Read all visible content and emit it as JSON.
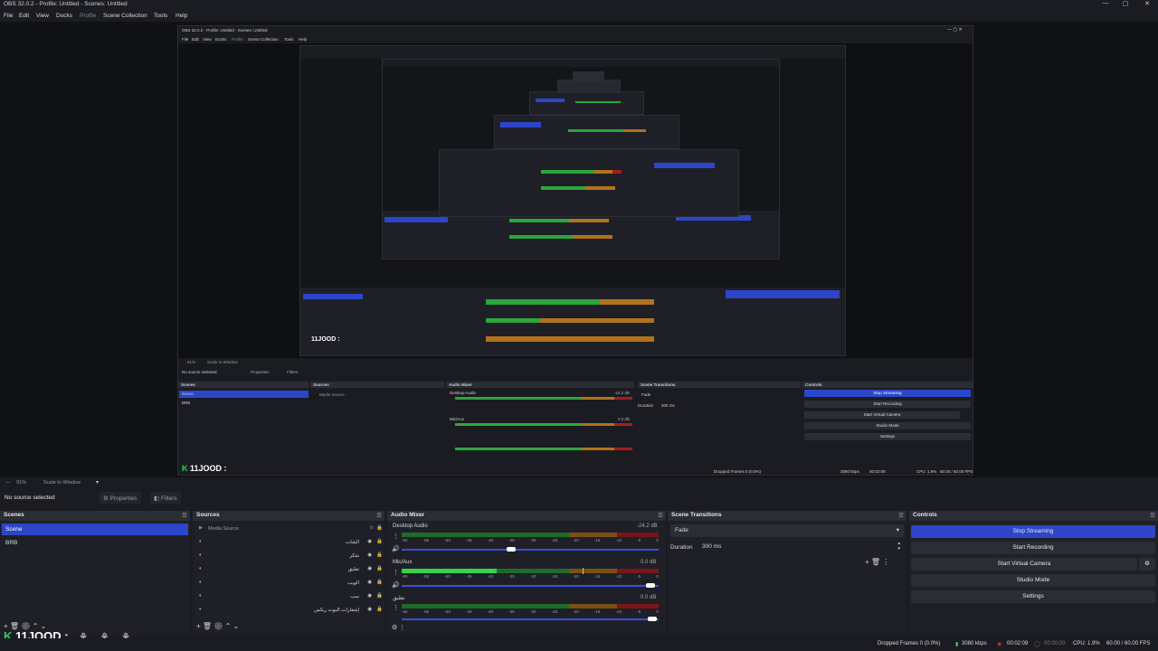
{
  "window": {
    "title": "OBS 32.0.2 - Profile: Untitled - Scenes: Untitled"
  },
  "menu": [
    "File",
    "Edit",
    "View",
    "Docks",
    "Profile",
    "Scene Collection",
    "Tools",
    "Help"
  ],
  "nested": {
    "title": "OBS 32.0.2 - Profile: Untitled - Scenes: Untitled",
    "menu": [
      "File",
      "Edit",
      "View",
      "Docks",
      "Profile",
      "Scene Collection",
      "Tools",
      "Help"
    ],
    "zoom": "91%",
    "scale": "Scale to Window",
    "no_source": "No source selected",
    "properties": "Properties",
    "filters": "Filters",
    "docks": {
      "scenes": "Scenes",
      "sources": "Sources",
      "mixer": "Audio Mixer",
      "transitions": "Scene Transitions",
      "controls": "Controls"
    },
    "scenes": [
      "Scene",
      "BRB"
    ],
    "media_source": "Media Source",
    "desktop_audio": "Desktop Audio",
    "desktop_db": "-24.2 dB",
    "mic_aux": "Mic/Aux",
    "mic_db": "0.0 dB",
    "fade": "Fade",
    "duration_label": "Duration",
    "duration_value": "300 ms",
    "controls": [
      "Stop Streaming",
      "Start Recording",
      "Start Virtual Camera",
      "Studio Mode",
      "Settings"
    ],
    "logo": "11JOOD :",
    "dropped": "Dropped Frames 0 (0.0%)",
    "kbps": "3080 kbps",
    "time": "00:02:09",
    "cpu": "CPU: 1.9%",
    "fps": "60.00 / 60.00 FPS"
  },
  "zoom": {
    "percent": "91%",
    "mode": "Scale to Window"
  },
  "source_toolbar": {
    "no_source": "No source selected",
    "properties": "Properties",
    "filters": "Filters"
  },
  "scenes": {
    "title": "Scenes",
    "items": [
      "Scene",
      "BRB"
    ],
    "selected": "Scene"
  },
  "sources": {
    "title": "Sources",
    "items": [
      "Media Source",
      "الشات",
      "شكر",
      "تعليق",
      "الويب",
      "سب",
      "إشعارات البوت ريكس"
    ]
  },
  "mixer": {
    "title": "Audio Mixer",
    "channels": [
      {
        "name": "Desktop Audio",
        "db": "-24.2 dB",
        "level": 0.0
      },
      {
        "name": "Mic/Aux",
        "db": "0.0 dB",
        "level": 0.42
      },
      {
        "name": "تعليق",
        "db": "0.0 dB",
        "level": 0.0
      }
    ],
    "ticks": [
      "-60",
      "-55",
      "-50",
      "-45",
      "-40",
      "-35",
      "-30",
      "-25",
      "-20",
      "-15",
      "-10",
      "-5",
      "0"
    ]
  },
  "transitions": {
    "title": "Scene Transitions",
    "type": "Fade",
    "duration_label": "Duration",
    "duration_value": "300 ms"
  },
  "controls": {
    "title": "Controls",
    "stop_streaming": "Stop Streaming",
    "start_recording": "Start Recording",
    "start_virtual_camera": "Start Virtual Camera",
    "studio_mode": "Studio Mode",
    "settings": "Settings"
  },
  "overlay": {
    "logo_text": "11JOOD :"
  },
  "status": {
    "dropped": "Dropped Frames 0 (0.0%)",
    "kbps": "3080 kbps",
    "stream_time": "00:02:09",
    "record_time": "00:00:00",
    "cpu": "CPU: 1.9%",
    "fps": "60.00 / 60.00 FPS"
  },
  "colors": {
    "accent": "#2d46c9",
    "meter_green": "#2aa63b",
    "meter_orange": "#b0731b",
    "meter_red": "#a41e23",
    "logo_green": "#2bd15a"
  }
}
